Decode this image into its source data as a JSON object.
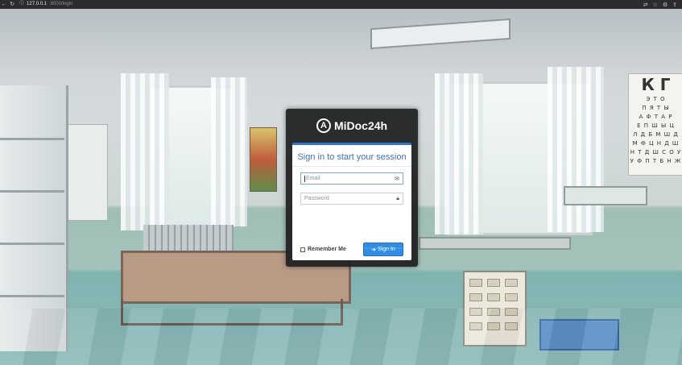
{
  "browser": {
    "back_icon": "arrow-left-icon",
    "reload_icon": "reload-icon",
    "info_icon": "info-icon",
    "url_host": "127.0.0.1",
    "url_path": ":8000/login",
    "right_icons": [
      "translate-icon",
      "star-icon",
      "extensions-icon",
      "share-icon"
    ]
  },
  "scene": {
    "eye_chart_rows": [
      "К Г",
      "Э Т О",
      "П Я Т Ы",
      "А Ф Т А Р",
      "Е П Ш Ы Ц",
      "Л Д Б М Ш Д",
      "М Ф Ц Н Д Ш",
      "Н Т Д Ш С О У",
      "У Ф П Т Б Н Ж"
    ]
  },
  "login": {
    "brand_logo_letter": "A",
    "brand_name": "MiDoc24h",
    "title": "Sign in to start your session",
    "email_placeholder": "Email",
    "password_placeholder": "Password",
    "remember_label": "Remember Me",
    "signin_label": "Sign In",
    "email_icon": "envelope-icon",
    "password_icon": "lock-icon",
    "signin_icon": "sign-in-icon"
  },
  "colors": {
    "accent": "#2f8de4",
    "title": "#3f70b6",
    "panel": "#1e1e20"
  }
}
